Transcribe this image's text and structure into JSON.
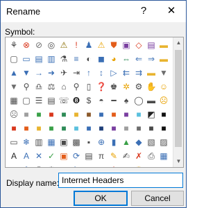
{
  "dialog": {
    "title": "Rename",
    "help_glyph": "?",
    "close_glyph": "✕"
  },
  "symbols": {
    "label": "Symbol:",
    "items": [
      {
        "glyph": "⚘",
        "color": "#3a3a3a",
        "name": "org-chart-icon"
      },
      {
        "glyph": "⊗",
        "color": "#d9381e",
        "name": "cancel-icon"
      },
      {
        "glyph": "⊘",
        "color": "#6e6e6e",
        "name": "prohibited-icon"
      },
      {
        "glyph": "◎",
        "color": "#4a4a4a",
        "name": "target-icon"
      },
      {
        "glyph": "⚠",
        "color": "#8a6d00",
        "name": "warning-sign-icon"
      },
      {
        "glyph": "!",
        "color": "#d9381e",
        "name": "important-icon"
      },
      {
        "glyph": "♟",
        "color": "#3b6fb5",
        "name": "person-icon"
      },
      {
        "glyph": "⚠",
        "color": "#e8a200",
        "name": "alert-icon"
      },
      {
        "glyph": "⛊",
        "color": "#e35d1a",
        "name": "shield-icon"
      },
      {
        "glyph": "▣",
        "color": "#7a3fa0",
        "name": "save-icon"
      },
      {
        "glyph": "◇",
        "color": "#d9381e",
        "name": "tag-icon"
      },
      {
        "glyph": "▤",
        "color": "#7a3fa0",
        "name": "calendar-icon"
      },
      {
        "glyph": "▬",
        "color": "#e8b430",
        "name": "folder-icon"
      },
      {
        "glyph": "▢",
        "color": "#4a4a4a",
        "name": "document-icon"
      },
      {
        "glyph": "▭",
        "color": "#3b6fb5",
        "name": "window-icon"
      },
      {
        "glyph": "▤",
        "color": "#3b6fb5",
        "name": "table-icon"
      },
      {
        "glyph": "▥",
        "color": "#3b6fb5",
        "name": "list-icon"
      },
      {
        "glyph": "⚗",
        "color": "#4a4a4a",
        "name": "flask-icon"
      },
      {
        "glyph": "≡",
        "color": "#3b6fb5",
        "name": "lines-icon"
      },
      {
        "glyph": "◐",
        "color": "#4a4a4a",
        "name": "theme-icon"
      },
      {
        "glyph": "◼",
        "color": "#3b6fb5",
        "name": "square-icon"
      },
      {
        "glyph": "◕",
        "color": "#e8a200",
        "name": "pie-icon"
      },
      {
        "glyph": "⇔",
        "color": "#2e8b57",
        "name": "sync-icon"
      },
      {
        "glyph": "⇐",
        "color": "#3b6fb5",
        "name": "back-icon"
      },
      {
        "glyph": "⇒",
        "color": "#3b6fb5",
        "name": "forward-icon"
      },
      {
        "glyph": "▬",
        "color": "#e8b430",
        "name": "folder-2-icon"
      },
      {
        "glyph": "▲",
        "color": "#3b6fb5",
        "name": "triangle-up-icon"
      },
      {
        "glyph": "▼",
        "color": "#3b6fb5",
        "name": "triangle-down-icon"
      },
      {
        "glyph": "→",
        "color": "#3b6fb5",
        "name": "arrow-right-icon"
      },
      {
        "glyph": "➜",
        "color": "#3b6fb5",
        "name": "arrow-circle-icon"
      },
      {
        "glyph": "✈",
        "color": "#4a4a4a",
        "name": "pin-icon"
      },
      {
        "glyph": "⇥",
        "color": "#4a4a4a",
        "name": "next-icon"
      },
      {
        "glyph": "↑",
        "color": "#3b6fb5",
        "name": "arrow-up-icon"
      },
      {
        "glyph": "↕",
        "color": "#3b6fb5",
        "name": "sort-icon"
      },
      {
        "glyph": "▷",
        "color": "#3b6fb5",
        "name": "flag-play-icon"
      },
      {
        "glyph": "⇇",
        "color": "#3b6fb5",
        "name": "rewind-icon"
      },
      {
        "glyph": "⇉",
        "color": "#3b6fb5",
        "name": "fast-forward-icon"
      },
      {
        "glyph": "▬",
        "color": "#e8b430",
        "name": "folder-3-icon"
      },
      {
        "glyph": "▼",
        "color": "#6e6e6e",
        "name": "filter-icon"
      },
      {
        "glyph": "▼",
        "color": "#6e6e6e",
        "name": "funnel-icon"
      },
      {
        "glyph": "⚲",
        "color": "#4a4a4a",
        "name": "search-icon"
      },
      {
        "glyph": "♎",
        "color": "#4a4a4a",
        "name": "scales-icon"
      },
      {
        "glyph": "⚖",
        "color": "#4a4a4a",
        "name": "balance-icon"
      },
      {
        "glyph": "⌂",
        "color": "#4a4a4a",
        "name": "home-icon"
      },
      {
        "glyph": "⚲",
        "color": "#4a4a4a",
        "name": "key-icon"
      },
      {
        "glyph": "▯",
        "color": "#4a4a4a",
        "name": "microphone-icon"
      },
      {
        "glyph": "❓",
        "color": "#3b6fb5",
        "name": "question-icon"
      },
      {
        "glyph": "♚",
        "color": "#4a4a4a",
        "name": "user-icon"
      },
      {
        "glyph": "✲",
        "color": "#e8a200",
        "name": "sun-icon"
      },
      {
        "glyph": "⚙",
        "color": "#4a4a4a",
        "name": "settings-icon"
      },
      {
        "glyph": "✋",
        "color": "#4a4a4a",
        "name": "hand-icon"
      },
      {
        "glyph": "☺",
        "color": "#e8a200",
        "name": "smiley-icon"
      },
      {
        "glyph": "▦",
        "color": "#4a4a4a",
        "name": "calculator-icon"
      },
      {
        "glyph": "▢",
        "color": "#4a4a4a",
        "name": "blank-doc-icon"
      },
      {
        "glyph": "☰",
        "color": "#4a4a4a",
        "name": "list-doc-icon"
      },
      {
        "glyph": "▤",
        "color": "#4a4a4a",
        "name": "spreadsheet-icon"
      },
      {
        "glyph": "☏",
        "color": "#4a4a4a",
        "name": "phone-icon"
      },
      {
        "glyph": "❽",
        "color": "#222222",
        "name": "eight-ball-icon"
      },
      {
        "glyph": "$",
        "color": "#4a4a4a",
        "name": "dollar-icon"
      },
      {
        "glyph": "◓",
        "color": "#4a4a4a",
        "name": "eye-icon"
      },
      {
        "glyph": "━",
        "color": "#4a4a4a",
        "name": "dash-icon"
      },
      {
        "glyph": "♠",
        "color": "#4a4a4a",
        "name": "spade-icon"
      },
      {
        "glyph": "◯",
        "color": "#4a4a4a",
        "name": "circle-icon"
      },
      {
        "glyph": "▬",
        "color": "#4a4a4a",
        "name": "rectangle-icon"
      },
      {
        "glyph": "☹",
        "color": "#e8a200",
        "name": "sad-icon"
      },
      {
        "glyph": "☹",
        "color": "#6e6e6e",
        "name": "frown-icon"
      },
      {
        "glyph": "■",
        "color": "#9e9e9e",
        "name": "gray-swatch-icon"
      },
      {
        "glyph": "■",
        "color": "#3aa048",
        "name": "green-swatch-icon"
      },
      {
        "glyph": "■",
        "color": "#d9381e",
        "name": "red-swatch-icon"
      },
      {
        "glyph": "■",
        "color": "#2e8b57",
        "name": "dark-green-swatch-icon"
      },
      {
        "glyph": "■",
        "color": "#e8b430",
        "name": "yellow-swatch-icon"
      },
      {
        "glyph": "■",
        "color": "#8b5a2b",
        "name": "brown-swatch-icon"
      },
      {
        "glyph": "■",
        "color": "#3b6fb5",
        "name": "blue-swatch-icon"
      },
      {
        "glyph": "■",
        "color": "#e35d1a",
        "name": "orange-swatch-icon"
      },
      {
        "glyph": "■",
        "color": "#7a3fa0",
        "name": "purple-swatch-icon"
      },
      {
        "glyph": "■",
        "color": "#5bc0de",
        "name": "light-blue-swatch-icon"
      },
      {
        "glyph": "◩",
        "color": "#222222",
        "name": "half-swatch-icon"
      },
      {
        "glyph": "■",
        "color": "#111111",
        "name": "black-swatch-icon"
      },
      {
        "glyph": "■",
        "color": "#d9381e",
        "name": "red-square-icon"
      },
      {
        "glyph": "■",
        "color": "#e35d1a",
        "name": "orange-square-icon"
      },
      {
        "glyph": "■",
        "color": "#e8b430",
        "name": "gold-square-icon"
      },
      {
        "glyph": "■",
        "color": "#3aa048",
        "name": "green-square-icon"
      },
      {
        "glyph": "■",
        "color": "#2e8b57",
        "name": "teal-square-icon"
      },
      {
        "glyph": "■",
        "color": "#5bc0de",
        "name": "sky-square-icon"
      },
      {
        "glyph": "■",
        "color": "#3b6fb5",
        "name": "blue-square-icon"
      },
      {
        "glyph": "■",
        "color": "#1f3f7a",
        "name": "navy-square-icon"
      },
      {
        "glyph": "■",
        "color": "#7a3fa0",
        "name": "violet-square-icon"
      },
      {
        "glyph": "■",
        "color": "#9e9e9e",
        "name": "silver-square-icon"
      },
      {
        "glyph": "■",
        "color": "#6e6e6e",
        "name": "slate-square-icon"
      },
      {
        "glyph": "■",
        "color": "#4a4a4a",
        "name": "charcoal-square-icon"
      },
      {
        "glyph": "■",
        "color": "#111111",
        "name": "ink-square-icon"
      },
      {
        "glyph": "▭",
        "color": "#4a4a4a",
        "name": "frame-icon"
      },
      {
        "glyph": "❄",
        "color": "#3b6fb5",
        "name": "snowflake-icon"
      },
      {
        "glyph": "▥",
        "color": "#4a4a4a",
        "name": "columns-icon"
      },
      {
        "glyph": "▦",
        "color": "#3b6fb5",
        "name": "grid-icon"
      },
      {
        "glyph": "▣",
        "color": "#4a4a4a",
        "name": "boxed-icon"
      },
      {
        "glyph": "▩",
        "color": "#4a4a4a",
        "name": "checker-icon"
      },
      {
        "glyph": "▪",
        "color": "#4a4a4a",
        "name": "small-square-icon"
      },
      {
        "glyph": "⊕",
        "color": "#3b6fb5",
        "name": "add-circle-icon"
      },
      {
        "glyph": "▮",
        "color": "#3b6fb5",
        "name": "bar-icon"
      },
      {
        "glyph": "▲",
        "color": "#3aa048",
        "name": "mountain-icon"
      },
      {
        "glyph": "◆",
        "color": "#3b6fb5",
        "name": "diamond-icon"
      },
      {
        "glyph": "▧",
        "color": "#4a4a4a",
        "name": "hatch-icon"
      },
      {
        "glyph": "▨",
        "color": "#4a4a4a",
        "name": "hatch-2-icon"
      },
      {
        "glyph": "A",
        "color": "#222222",
        "name": "text-box-icon"
      },
      {
        "glyph": "A",
        "color": "#3b6fb5",
        "name": "text-fill-icon"
      },
      {
        "glyph": "✕",
        "color": "#3b6fb5",
        "name": "x-mark-icon"
      },
      {
        "glyph": "✓",
        "color": "#3aa048",
        "name": "check-mark-icon"
      },
      {
        "glyph": "▣",
        "color": "#e35d1a",
        "name": "photo-icon"
      },
      {
        "glyph": "⟳",
        "color": "#3b6fb5",
        "name": "refresh-icon"
      },
      {
        "glyph": "▤",
        "color": "#4a4a4a",
        "name": "report-icon"
      },
      {
        "glyph": "π",
        "color": "#4a4a4a",
        "name": "pi-icon"
      },
      {
        "glyph": "✎",
        "color": "#e8a200",
        "name": "paint-icon"
      },
      {
        "glyph": "✍",
        "color": "#4a4a4a",
        "name": "brush-icon"
      },
      {
        "glyph": "✗",
        "color": "#d9381e",
        "name": "delete-icon"
      },
      {
        "glyph": "⎙",
        "color": "#4a4a4a",
        "name": "printer-icon"
      },
      {
        "glyph": "▦",
        "color": "#3b6fb5",
        "name": "layout-icon"
      },
      {
        "glyph": "▶",
        "color": "#3b6fb5",
        "name": "play-icon"
      },
      {
        "glyph": "⚓",
        "color": "#3b6fb5",
        "name": "anchor-icon"
      },
      {
        "glyph": "⚇",
        "color": "#4a4a4a",
        "name": "people-icon"
      },
      {
        "glyph": "⚙",
        "color": "#4a4a4a",
        "name": "cog-icon"
      },
      {
        "glyph": "▢",
        "color": "#4a4a4a",
        "name": "doc-blank-icon"
      },
      {
        "glyph": "✎",
        "color": "#3b6fb5",
        "name": "pen-icon"
      },
      {
        "glyph": "▭",
        "color": "#d9381e",
        "name": "eraser-icon"
      },
      {
        "glyph": "▥",
        "color": "#4a4a4a",
        "name": "book-icon"
      },
      {
        "glyph": "A",
        "color": "#d9381e",
        "name": "font-color-icon"
      },
      {
        "glyph": "✔",
        "color": "#3aa048",
        "name": "approve-icon"
      },
      {
        "glyph": "♛",
        "color": "#e8a200",
        "name": "crown-icon"
      },
      {
        "glyph": "♥",
        "color": "#d9381e",
        "name": "heart-icon"
      },
      {
        "glyph": "✉",
        "color": "#4a4a4a",
        "name": "mail-icon"
      }
    ]
  },
  "display_name": {
    "label": "Display name:",
    "value": "Internet Headers"
  },
  "buttons": {
    "ok": "OK",
    "cancel": "Cancel"
  },
  "scrollbar": {
    "up_glyph": "▲",
    "down_glyph": "▼"
  }
}
